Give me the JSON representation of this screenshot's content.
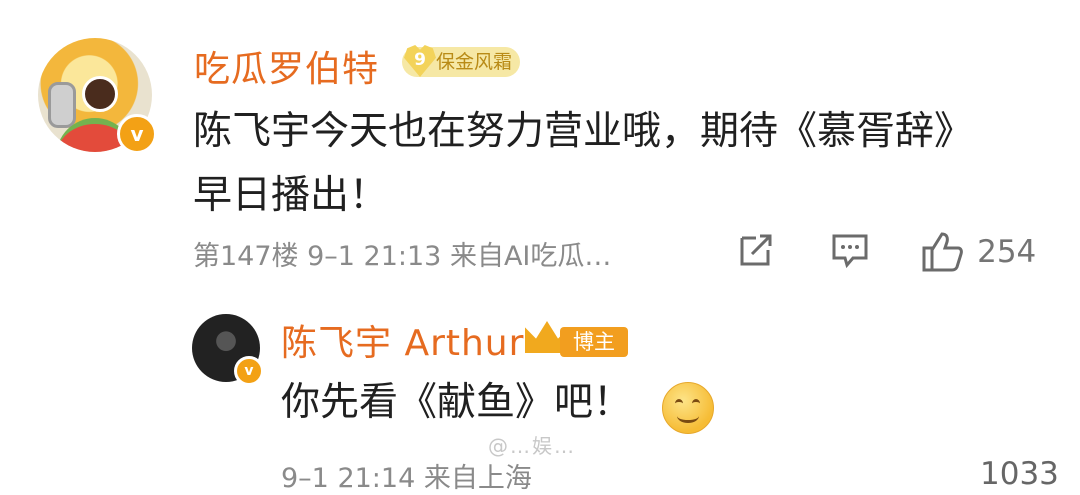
{
  "comment": {
    "author": "吃瓜罗伯特",
    "level_number": "9",
    "level_label": "保金风霜",
    "verified_mark": "v",
    "text_line1": "陈飞宇今天也在努力营业哦，期待《慕胥辞》",
    "text_line2": "早日播出！",
    "meta": "第147楼 9–1 21:13 来自AI吃瓜…",
    "like_count": "254",
    "icons": [
      "share-icon",
      "comment-icon",
      "like-icon"
    ]
  },
  "reply": {
    "author": "陈飞宇 Arthur",
    "badge_label": "博主",
    "verified_mark": "v",
    "text": "你先看《献鱼》吧！",
    "emoji": "smiley",
    "cut_meta": "9–1 21:14 来自上海",
    "cut_like_count": "1033"
  },
  "watermark": "@…娱…"
}
